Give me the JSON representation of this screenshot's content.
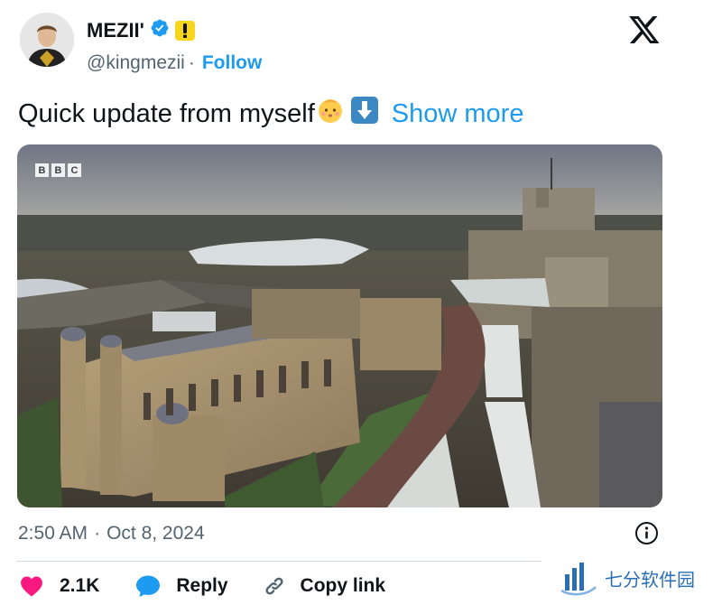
{
  "author": {
    "display_name": "MEZII'",
    "handle": "@kingmezii",
    "separator": "·",
    "follow_label": "Follow",
    "avatar_icon": "avatar-photo",
    "verified_icon": "verified-badge-icon",
    "affiliate_badge_icon": "exclamation-badge-icon"
  },
  "platform_logo": "x-logo-icon",
  "post": {
    "text": "Quick update from myself",
    "emojis": [
      "baby-face-emoji",
      "down-arrow-emoji"
    ],
    "show_more_label": "Show more",
    "media": {
      "broadcaster_logo": [
        "B",
        "B",
        "C"
      ]
    }
  },
  "meta": {
    "time": "2:50 AM",
    "dot": "·",
    "date": "Oct 8, 2024",
    "info_icon": "info-icon"
  },
  "actions": {
    "like_count": "2.1K",
    "reply_label": "Reply",
    "copy_link_label": "Copy link"
  },
  "watermark": {
    "text": "七分软件园"
  },
  "colors": {
    "accent": "#1d9bf0",
    "like": "#f91880",
    "secondary_text": "#536471",
    "badge_yellow": "#f7d51d"
  }
}
